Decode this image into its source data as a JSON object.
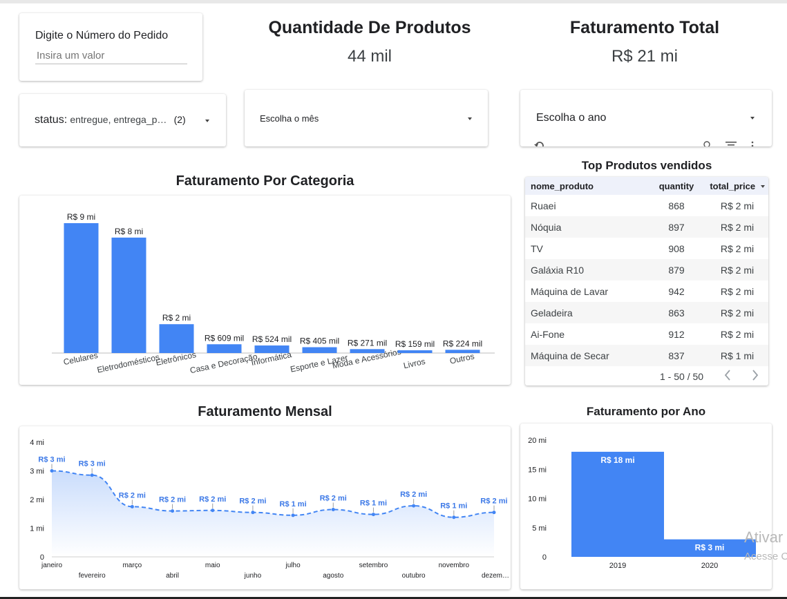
{
  "order_filter": {
    "label": "Digite o Número do Pedido",
    "placeholder": "Insira um valor"
  },
  "kpis": {
    "quantity": {
      "title": "Quantidade De Produtos",
      "value": "44 mil"
    },
    "revenue": {
      "title": "Faturamento Total",
      "value": "R$ 21 mi"
    }
  },
  "filters": {
    "status": {
      "label": "status",
      "value": "entregue, entrega_p…",
      "count": "(2)"
    },
    "month": {
      "label": "Escolha o mês"
    },
    "year": {
      "label": "Escolha o ano"
    }
  },
  "top_products": {
    "title": "Top Produtos vendidos",
    "columns": [
      "nome_produto",
      "quantity",
      "total_price"
    ],
    "rows": [
      [
        "Ruaei",
        "868",
        "R$ 2 mi"
      ],
      [
        "Nóquia",
        "897",
        "R$ 2 mi"
      ],
      [
        "TV",
        "908",
        "R$ 2 mi"
      ],
      [
        "Galáxia R10",
        "879",
        "R$ 2 mi"
      ],
      [
        "Máquina de Lavar",
        "942",
        "R$ 2 mi"
      ],
      [
        "Geladeira",
        "863",
        "R$ 2 mi"
      ],
      [
        "Ai-Fone",
        "912",
        "R$ 2 mi"
      ],
      [
        "Máquina de Secar",
        "837",
        "R$ 1 mi"
      ]
    ],
    "pagination": "1 - 50 / 50"
  },
  "colors": {
    "accent": "#4285f4",
    "bar": "#4285f4",
    "line": "#4285f4",
    "data_label_blue": "#3b78e7"
  },
  "icons": [
    "chevron-left-icon",
    "chevron-right-icon",
    "undo-icon",
    "zoom-icon",
    "filter-icon",
    "more-vert-icon",
    "dropdown-caret-icon",
    "sort-desc-icon"
  ],
  "chart_data": [
    {
      "id": "categoria",
      "type": "bar",
      "title": "Faturamento Por Categoria",
      "categories": [
        "Celulares",
        "Eletrodomésticos",
        "Eletrônicos",
        "Casa e Decoração",
        "Informática",
        "Esporte e Lazer",
        "Moda e Acessórios",
        "Livros",
        "Outros"
      ],
      "values": [
        9000000,
        8000000,
        2000000,
        609000,
        524000,
        405000,
        271000,
        159000,
        224000
      ],
      "data_labels": [
        "R$ 9 mi",
        "R$ 8 mi",
        "R$ 2 mi",
        "R$ 609 mil",
        "R$ 524 mil",
        "R$ 405 mil",
        "R$ 271 mil",
        "R$ 159 mil",
        "R$ 224 mil"
      ],
      "ylim": [
        0,
        9000000
      ],
      "grid": false
    },
    {
      "id": "mensal",
      "type": "area",
      "title": "Faturamento Mensal",
      "x": [
        "janeiro",
        "fevereiro",
        "março",
        "abril",
        "maio",
        "junho",
        "julho",
        "agosto",
        "setembro",
        "outubro",
        "novembro",
        "dezem…"
      ],
      "values": [
        3000000,
        2850000,
        1750000,
        1600000,
        1620000,
        1550000,
        1450000,
        1650000,
        1480000,
        1780000,
        1380000,
        1550000
      ],
      "data_labels": [
        "R$ 3 mi",
        "R$ 3 mi",
        "R$ 2 mi",
        "R$ 2 mi",
        "R$ 2 mi",
        "R$ 2 mi",
        "R$ 1 mi",
        "R$ 2 mi",
        "R$ 1 mi",
        "R$ 2 mi",
        "R$ 1 mi",
        "R$ 2 mi"
      ],
      "ylim": [
        0,
        4000000
      ],
      "yticks": [
        0,
        1000000,
        2000000,
        3000000,
        4000000
      ],
      "ytick_labels": [
        "0",
        "1 mi",
        "2 mi",
        "3 mi",
        "4 mi"
      ],
      "line_style": "dashed",
      "grid": false
    },
    {
      "id": "ano",
      "type": "bar",
      "title": "Faturamento por Ano",
      "categories": [
        "2019",
        "2020"
      ],
      "values": [
        18000000,
        3000000
      ],
      "data_labels": [
        "R$ 18 mi",
        "R$ 3 mi"
      ],
      "ylim": [
        0,
        20000000
      ],
      "yticks": [
        0,
        5000000,
        10000000,
        15000000,
        20000000
      ],
      "ytick_labels": [
        "0",
        "5 mi",
        "10 mi",
        "15 mi",
        "20 mi"
      ],
      "grid": false
    }
  ],
  "watermark": {
    "line1": "Ativar",
    "line2": "Acesse C"
  }
}
